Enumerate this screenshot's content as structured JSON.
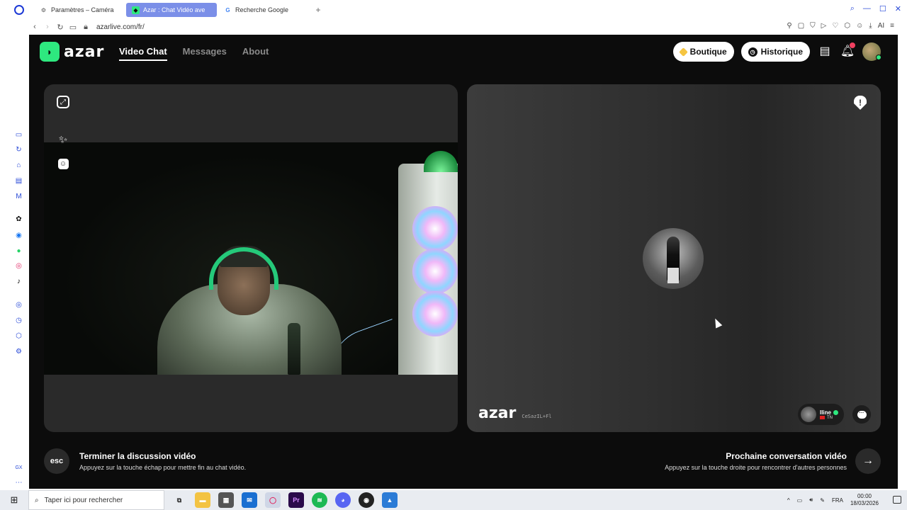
{
  "browser": {
    "tabs": [
      {
        "label": "Paramètres – Caméra",
        "icon": "gear-icon",
        "active": false
      },
      {
        "label": "Azar : Chat Vidéo ave",
        "icon": "azar-icon",
        "active": true
      },
      {
        "label": "Recherche Google",
        "icon": "google-icon",
        "active": false
      }
    ],
    "url": "azarlive.com/fr/",
    "aria_label": "AI"
  },
  "azar": {
    "logo_text": "azar",
    "nav": [
      {
        "label": "Video Chat",
        "active": true
      },
      {
        "label": "Messages",
        "active": false
      },
      {
        "label": "About",
        "active": false
      }
    ],
    "shop_label": "Boutique",
    "history_label": "Historique",
    "notifications_count": "5",
    "remote": {
      "watermark_logo": "azar",
      "watermark_id": "CeSazIL+Fl",
      "peer_name": "Iline",
      "peer_country": "TN"
    },
    "footer": {
      "end_key": "esc",
      "end_title": "Terminer la discussion vidéo",
      "end_sub": "Appuyez sur la touche échap pour mettre fin au chat vidéo.",
      "next_title": "Prochaine conversation vidéo",
      "next_sub": "Appuyez sur la touche droite pour rencontrer d'autres personnes",
      "next_icon": "arrow-right-icon"
    }
  },
  "taskbar": {
    "search_placeholder": "Taper ici pour rechercher",
    "language": "FRA",
    "time": "00:00",
    "date": "18/03/2026"
  },
  "colors": {
    "accent": "#2ee87f",
    "browser_blue": "#2d4fe0",
    "page_bg": "#0c0c0c"
  }
}
